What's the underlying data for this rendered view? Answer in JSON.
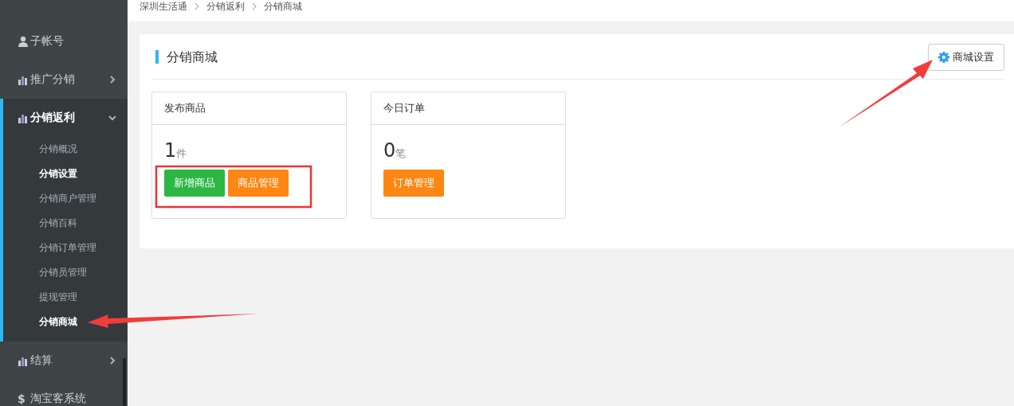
{
  "sidebar": {
    "items": [
      {
        "label": "子帐号",
        "kind": "user",
        "expandable": false,
        "expanded": false
      },
      {
        "label": "推广分销",
        "kind": "chart",
        "expandable": true,
        "expanded": false
      },
      {
        "label": "分销返利",
        "kind": "chart",
        "expandable": true,
        "expanded": true,
        "children": [
          {
            "label": "分销概况",
            "selected": false
          },
          {
            "label": "分销设置",
            "selected": true
          },
          {
            "label": "分销商户管理",
            "selected": false
          },
          {
            "label": "分销百科",
            "selected": false
          },
          {
            "label": "分销订单管理",
            "selected": false
          },
          {
            "label": "分销员管理",
            "selected": false
          },
          {
            "label": "提现管理",
            "selected": false
          },
          {
            "label": "分销商城",
            "selected": true
          }
        ]
      },
      {
        "label": "结算",
        "kind": "chart",
        "expandable": true,
        "expanded": false
      },
      {
        "label": "淘宝客系统",
        "kind": "glyph",
        "glyph": "$",
        "expandable": false,
        "expanded": false
      }
    ]
  },
  "breadcrumb": [
    "深圳生活通",
    "分销返利",
    "分销商城"
  ],
  "panel": {
    "title": "分销商城",
    "settings_button": "商城设置",
    "cards": [
      {
        "title": "发布商品",
        "count": "1",
        "unit": "件",
        "buttons": [
          {
            "label": "新增商品",
            "kind": "green"
          },
          {
            "label": "商品管理",
            "kind": "orange"
          }
        ]
      },
      {
        "title": "今日订单",
        "count": "0",
        "unit": "笔",
        "buttons": [
          {
            "label": "订单管理",
            "kind": "orange"
          }
        ]
      }
    ]
  }
}
